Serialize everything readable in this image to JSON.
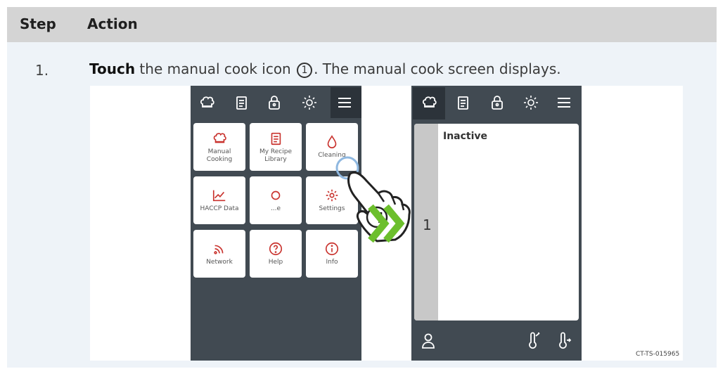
{
  "table": {
    "header_step": "Step",
    "header_action": "Action"
  },
  "step": {
    "number": "1.",
    "verb": "Touch",
    "text_before": "the manual cook icon",
    "callout": "1",
    "text_after": ". The manual cook screen displays."
  },
  "screen_home": {
    "topbar_icons": [
      "chef-hat-icon",
      "recipe-book-icon",
      "lock-icon",
      "brightness-icon",
      "menu-icon"
    ],
    "tiles": [
      {
        "label": "Manual\nCooking",
        "icon": "chef-hat-icon"
      },
      {
        "label": "My Recipe\nLibrary",
        "icon": "recipe-book-icon"
      },
      {
        "label": "Cleaning",
        "icon": "water-drop-icon"
      },
      {
        "label": "HACCP Data",
        "icon": "chart-icon"
      },
      {
        "label": "...e",
        "icon": "partial-icon"
      },
      {
        "label": "Settings",
        "icon": "gear-icon"
      },
      {
        "label": "Network",
        "icon": "wifi-icon"
      },
      {
        "label": "Help",
        "icon": "question-icon"
      },
      {
        "label": "Info",
        "icon": "info-icon"
      }
    ]
  },
  "screen_manual": {
    "status": "Inactive",
    "cavity_number": "1"
  },
  "figure_code": "CT-TS-015965",
  "colors": {
    "accent_red": "#c9332e",
    "arrow_green": "#6cbf2c",
    "screen_bg": "#414a52"
  }
}
